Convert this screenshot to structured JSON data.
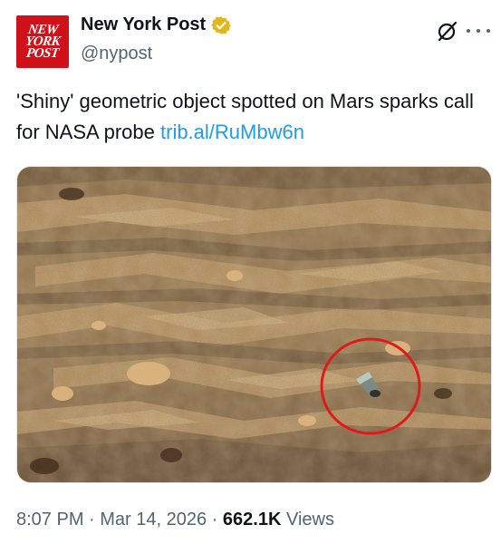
{
  "account": {
    "logo_lines": [
      "NEW",
      "YORK",
      "POST"
    ],
    "display_name": "New York Post",
    "handle": "@nypost",
    "verified_color": "#e2b719"
  },
  "tweet": {
    "text": "'Shiny' geometric object spotted on Mars sparks call for NASA probe",
    "link": "trib.al/RuMbw6n",
    "link_color": "#1d9bf0"
  },
  "media": {
    "icon": "mars-surface-photo",
    "highlight_color": "#e0191b"
  },
  "meta": {
    "time": "8:07 PM",
    "sep1": " · ",
    "date": "Mar 14, 2026",
    "sep2": " · ",
    "views_count": "662.1K",
    "views_label": " Views"
  }
}
